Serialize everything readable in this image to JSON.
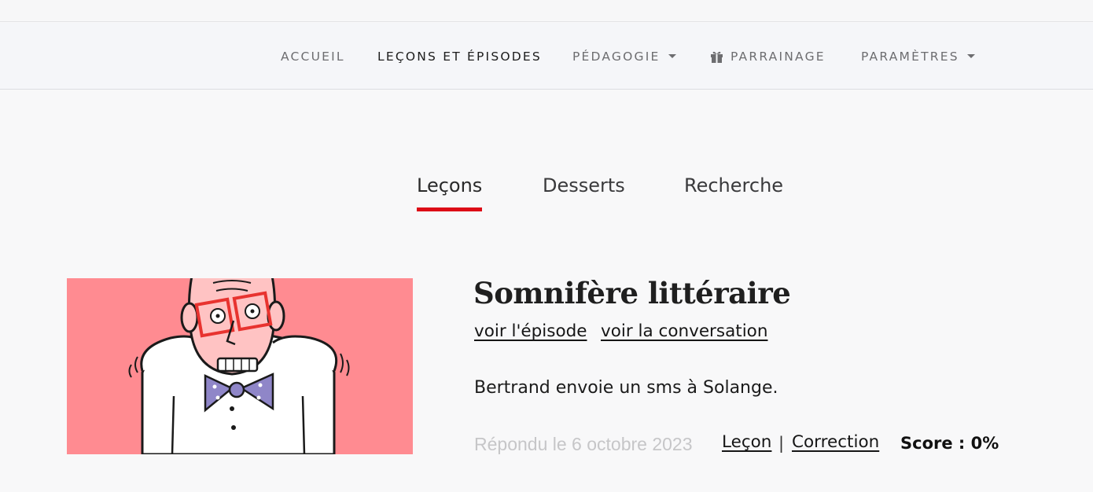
{
  "colors": {
    "background": "#f8f8f9",
    "navbar": "#f5f6f9",
    "accent": "#dd0b16",
    "thumbnail_bg": "#ff8b91",
    "muted_text": "#c6c6c8"
  },
  "nav": {
    "items": [
      {
        "label": "ACCUEIL",
        "active": false,
        "dropdown": false,
        "icon": null
      },
      {
        "label": "LEÇONS ET ÉPISODES",
        "active": true,
        "dropdown": false,
        "icon": null
      },
      {
        "label": "PÉDAGOGIE",
        "active": false,
        "dropdown": true,
        "icon": null
      },
      {
        "label": "PARRAINAGE",
        "active": false,
        "dropdown": false,
        "icon": "gift-icon"
      },
      {
        "label": "PARAMÈTRES",
        "active": false,
        "dropdown": true,
        "icon": null
      }
    ]
  },
  "tabs": [
    {
      "label": "Leçons",
      "active": true
    },
    {
      "label": "Desserts",
      "active": false
    },
    {
      "label": "Recherche",
      "active": false
    }
  ],
  "lesson": {
    "title": "Somnifère littéraire",
    "episode_link": "voir l'épisode",
    "conversation_link": "voir la conversation",
    "description": "Bertrand envoie un sms à Solange.",
    "answered_date": "Répondu le 6 octobre 2023",
    "lesson_link": "Leçon",
    "separator": "|",
    "correction_link": "Correction",
    "score": "Score : 0%",
    "thumbnail": "illustration of a startled bald man with red glasses and a polka-dot bow tie"
  }
}
